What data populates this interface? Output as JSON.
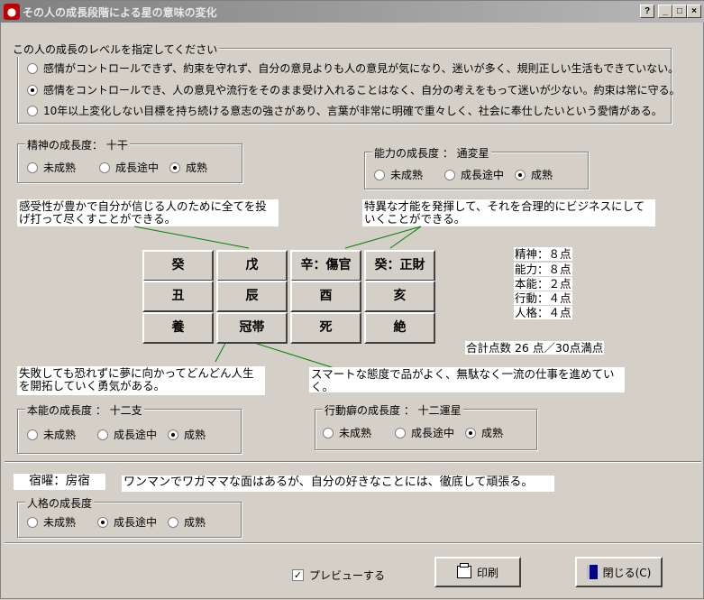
{
  "window": {
    "title": "その人の成長段階による星の意味の変化",
    "buttons": {
      "help": "?",
      "minimize": "_",
      "maximize": "□",
      "close": "×"
    }
  },
  "level_group": {
    "legend": "この人の成長のレベルを指定してください",
    "options": [
      {
        "label": "感情がコントロールできず、約束を守れず、自分の意見よりも人の意見が気になり、迷いが多く、規則正しい生活もできていない。",
        "selected": false
      },
      {
        "label": "感情をコントロールでき、人の意見や流行をそのまま受け入れることはなく、自分の考えをもって迷いが少ない。約束は常に守る。",
        "selected": true
      },
      {
        "label": "10年以上変化しない目標を持ち続ける意志の強さがあり、言葉が非常に明確で重々しく、社会に奉仕したいという愛情がある。",
        "selected": false
      }
    ]
  },
  "spirit_group": {
    "legend": "精神の成長度： 十干",
    "options": [
      {
        "label": "未成熟",
        "selected": false
      },
      {
        "label": "成長途中",
        "selected": false
      },
      {
        "label": "成熟",
        "selected": true
      }
    ]
  },
  "ability_group": {
    "legend": "能力の成長度 ： 通変星",
    "options": [
      {
        "label": "未成熟",
        "selected": false
      },
      {
        "label": "成長途中",
        "selected": false
      },
      {
        "label": "成熟",
        "selected": true
      }
    ]
  },
  "instinct_group": {
    "legend": "本能の成長度 ： 十二支",
    "options": [
      {
        "label": "未成熟",
        "selected": false
      },
      {
        "label": "成長途中",
        "selected": false
      },
      {
        "label": "成熟",
        "selected": true
      }
    ]
  },
  "action_group": {
    "legend": "行動癖の成長度 ： 十二運星",
    "options": [
      {
        "label": "未成熟",
        "selected": false
      },
      {
        "label": "成長途中",
        "selected": false
      },
      {
        "label": "成熟",
        "selected": true
      }
    ]
  },
  "personality_group": {
    "legend": "人格の成長度",
    "options": [
      {
        "label": "未成熟",
        "selected": false
      },
      {
        "label": "成長途中",
        "selected": true
      },
      {
        "label": "成熟",
        "selected": false
      }
    ]
  },
  "notes": {
    "spirit": "感受性が豊かで自分が信じる人のために全てを投げ打って尽くすことができる。",
    "ability": "特異な才能を発揮して、それを合理的にビジネスにしていくことができる。",
    "instinct": "失敗しても恐れずに夢に向かってどんどん人生を開拓していく勇気がある。",
    "action": "スマートな態度で品がよく、無駄なく一流の仕事を進めていく。",
    "personality": "ワンマンでワガママな面はあるが、自分の好きなことには、徹底して頑張る。"
  },
  "grid": {
    "rows": [
      [
        "癸",
        "戊",
        "辛：傷官",
        "癸：正財"
      ],
      [
        "丑",
        "辰",
        "酉",
        "亥"
      ],
      [
        "養",
        "冠帯",
        "死",
        "絶"
      ]
    ]
  },
  "scores": {
    "lines": [
      "精神：８点",
      "能力：８点",
      "本能：２点",
      "行動：４点",
      "人格：４点"
    ],
    "total": "合計点数 26 点／30点満点"
  },
  "shukuyo": "宿曜：房宿",
  "preview": {
    "label": "プレビューする",
    "checked": true
  },
  "print_button": "印刷",
  "close_button": "閉じる(C)"
}
